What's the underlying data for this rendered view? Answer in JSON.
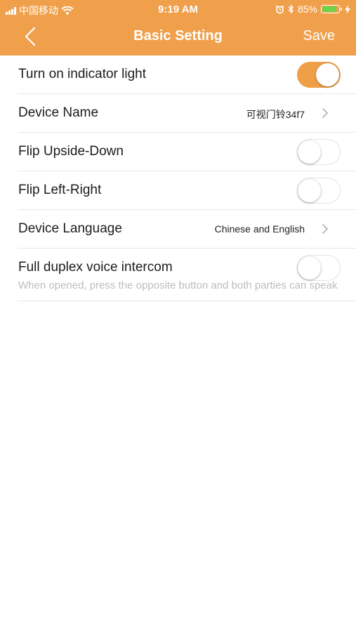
{
  "status_bar": {
    "carrier": "中国移动",
    "time": "9:19 AM",
    "battery_percent": "85%",
    "battery_level": 0.85,
    "icons": [
      "signal-icon",
      "wifi-icon",
      "alarm-icon",
      "bluetooth-icon",
      "battery-icon",
      "charging-icon"
    ]
  },
  "nav": {
    "title": "Basic Setting",
    "save_label": "Save",
    "back_icon": "chevron-left-icon"
  },
  "colors": {
    "accent": "#f0a04b",
    "toggle_on": "#ef9f48",
    "subtitle": "#bdbdbd",
    "battery_fill": "#6fd34a"
  },
  "settings": {
    "indicator_light": {
      "label": "Turn on indicator light",
      "enabled": true
    },
    "device_name": {
      "label": "Device Name",
      "value": "可视门铃34f7"
    },
    "flip_upside_down": {
      "label": "Flip Upside-Down",
      "enabled": false
    },
    "flip_left_right": {
      "label": "Flip Left-Right",
      "enabled": false
    },
    "device_language": {
      "label": "Device Language",
      "value": "Chinese and English"
    },
    "full_duplex": {
      "label": "Full duplex voice intercom",
      "description": "When opened, press the opposite button and both parties can speak",
      "enabled": false
    }
  }
}
